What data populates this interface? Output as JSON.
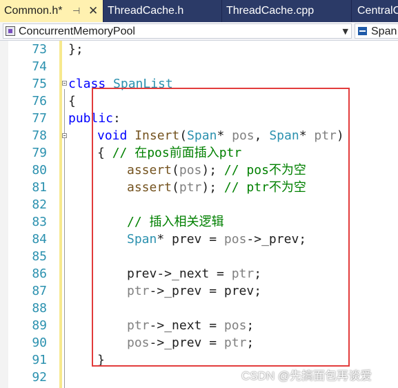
{
  "tabs": [
    {
      "label": "Common.h*",
      "active": true,
      "pin": "⊣",
      "close": "✕"
    },
    {
      "label": "ThreadCache.h",
      "active": false
    },
    {
      "label": "ThreadCache.cpp",
      "active": false
    },
    {
      "label": "CentralC",
      "active": false
    }
  ],
  "navbar": {
    "project": "ConcurrentMemoryPool",
    "scope": "Span"
  },
  "code": {
    "l73": {
      "num": "73",
      "t1": "};"
    },
    "l74": {
      "num": "74"
    },
    "l75": {
      "num": "75",
      "kw": "class",
      "name": "SpanList"
    },
    "l76": {
      "num": "76",
      "t1": "{"
    },
    "l77": {
      "num": "77",
      "kw": "public",
      "t1": ":"
    },
    "l78": {
      "num": "78",
      "kw": "void",
      "fn": "Insert",
      "p1": "(",
      "ty1": "Span",
      "p2": "* ",
      "par1": "pos",
      "p3": ", ",
      "ty2": "Span",
      "p4": "* ",
      "par2": "ptr",
      "p5": ")"
    },
    "l79": {
      "num": "79",
      "t1": "{ ",
      "cm": "// 在pos前面插入ptr"
    },
    "l80": {
      "num": "80",
      "fn": "assert",
      "p1": "(",
      "par1": "pos",
      "p2": "); ",
      "cm": "// pos不为空"
    },
    "l81": {
      "num": "81",
      "fn": "assert",
      "p1": "(",
      "par1": "ptr",
      "p2": "); ",
      "cm": "// ptr不为空"
    },
    "l82": {
      "num": "82"
    },
    "l83": {
      "num": "83",
      "cm": "// 插入相关逻辑"
    },
    "l84": {
      "num": "84",
      "ty": "Span",
      "t1": "* prev = ",
      "par1": "pos",
      "t2": "->_prev;"
    },
    "l85": {
      "num": "85"
    },
    "l86": {
      "num": "86",
      "t1": "prev->_next = ",
      "par1": "ptr",
      "t2": ";"
    },
    "l87": {
      "num": "87",
      "par1": "ptr",
      "t1": "->_prev = prev;"
    },
    "l88": {
      "num": "88"
    },
    "l89": {
      "num": "89",
      "par1": "ptr",
      "t1": "->_next = ",
      "par2": "pos",
      "t2": ";"
    },
    "l90": {
      "num": "90",
      "par1": "pos",
      "t1": "->_prev = ",
      "par2": "ptr",
      "t2": ";"
    },
    "l91": {
      "num": "91",
      "t1": "}"
    },
    "l92": {
      "num": "92"
    }
  },
  "watermark": "CSDN @先搞面包再谈爱",
  "colors": {
    "tab_strip": "#2b3a67",
    "active_tab": "#fff1b0",
    "keyword": "#0000ff",
    "type": "#2b91af",
    "comment": "#008000",
    "function": "#74531f",
    "highlight_box": "#e23b3b"
  }
}
